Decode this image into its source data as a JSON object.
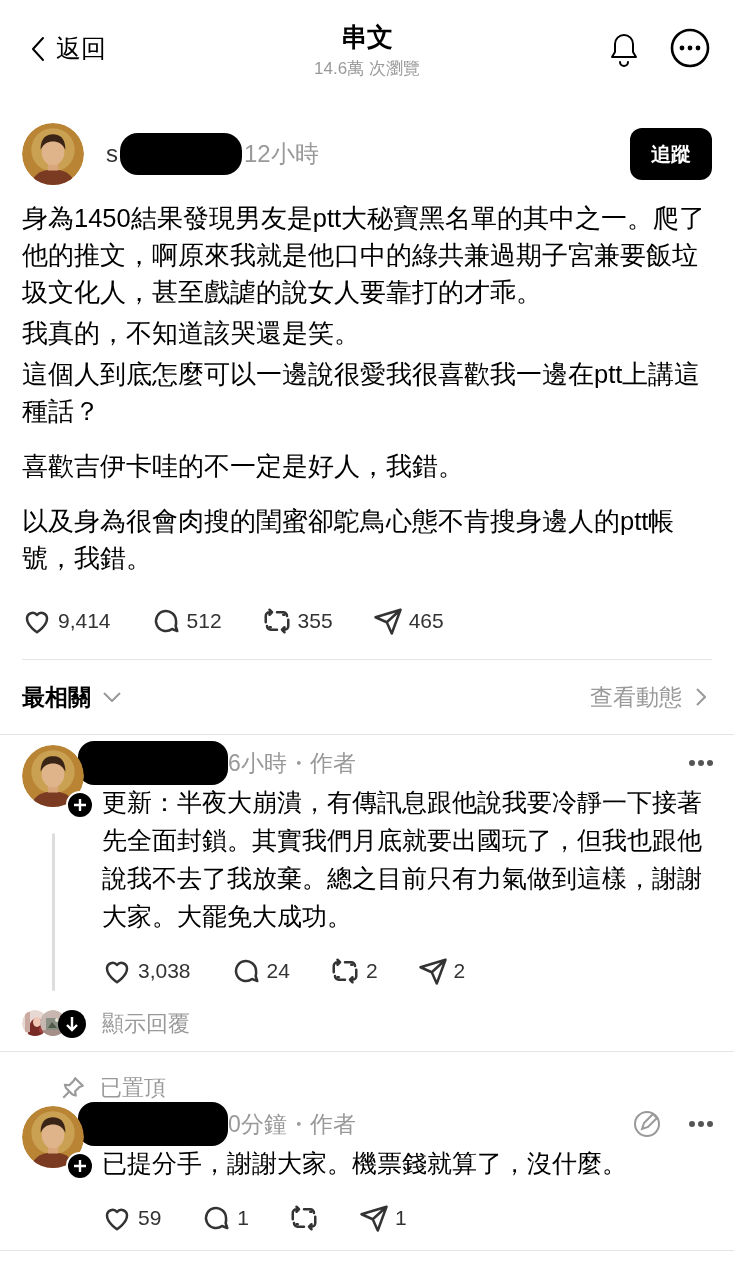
{
  "header": {
    "back_label": "返回",
    "title": "串文",
    "views": "14.6萬 次瀏覽"
  },
  "post": {
    "author_visible": "s",
    "time": "12小時",
    "follow_label": "追蹤",
    "paragraphs": [
      [
        "身為1450結果發現男友是ptt大秘寶黑名單的其中之一。爬了他的推文，啊原來我就是他口中的綠共兼過期子宮兼要飯垃圾文化人，甚至戲謔的說女人要靠打的才乖。",
        "我真的，不知道該哭還是笑。",
        "這個人到底怎麼可以一邊說很愛我很喜歡我一邊在ptt上講這種話？"
      ],
      [
        "喜歡吉伊卡哇的不一定是好人，我錯。"
      ],
      [
        "以及身為很會肉搜的閨蜜卻鴕鳥心態不肯搜身邊人的ptt帳號，我錯。"
      ]
    ],
    "stats": [
      {
        "kind": "like",
        "count": "9,414"
      },
      {
        "kind": "comment",
        "count": "512"
      },
      {
        "kind": "repost",
        "count": "355"
      },
      {
        "kind": "share",
        "count": "465"
      }
    ]
  },
  "sort": {
    "label": "最相關",
    "view_activity": "查看動態"
  },
  "replies": [
    {
      "pinned": false,
      "time": "6小時・作者",
      "editable": false,
      "text": "更新：半夜大崩潰，有傳訊息跟他說我要冷靜一下接著先全面封鎖。其實我們月底就要出國玩了，但我也跟他說我不去了我放棄。總之目前只有力氣做到這樣，謝謝大家。大罷免大成功。",
      "stats": [
        {
          "kind": "like",
          "count": "3,038"
        },
        {
          "kind": "comment",
          "count": "24"
        },
        {
          "kind": "repost",
          "count": "2"
        },
        {
          "kind": "share",
          "count": "2"
        }
      ],
      "show_replies": "顯示回覆"
    },
    {
      "pinned": true,
      "pinned_label": "已置頂",
      "time": "0分鐘・作者",
      "editable": true,
      "text": "已提分手，謝謝大家。機票錢就算了，沒什麼。",
      "stats": [
        {
          "kind": "like",
          "count": "59"
        },
        {
          "kind": "comment",
          "count": "1"
        },
        {
          "kind": "repost"
        },
        {
          "kind": "share",
          "count": "1"
        }
      ]
    }
  ]
}
